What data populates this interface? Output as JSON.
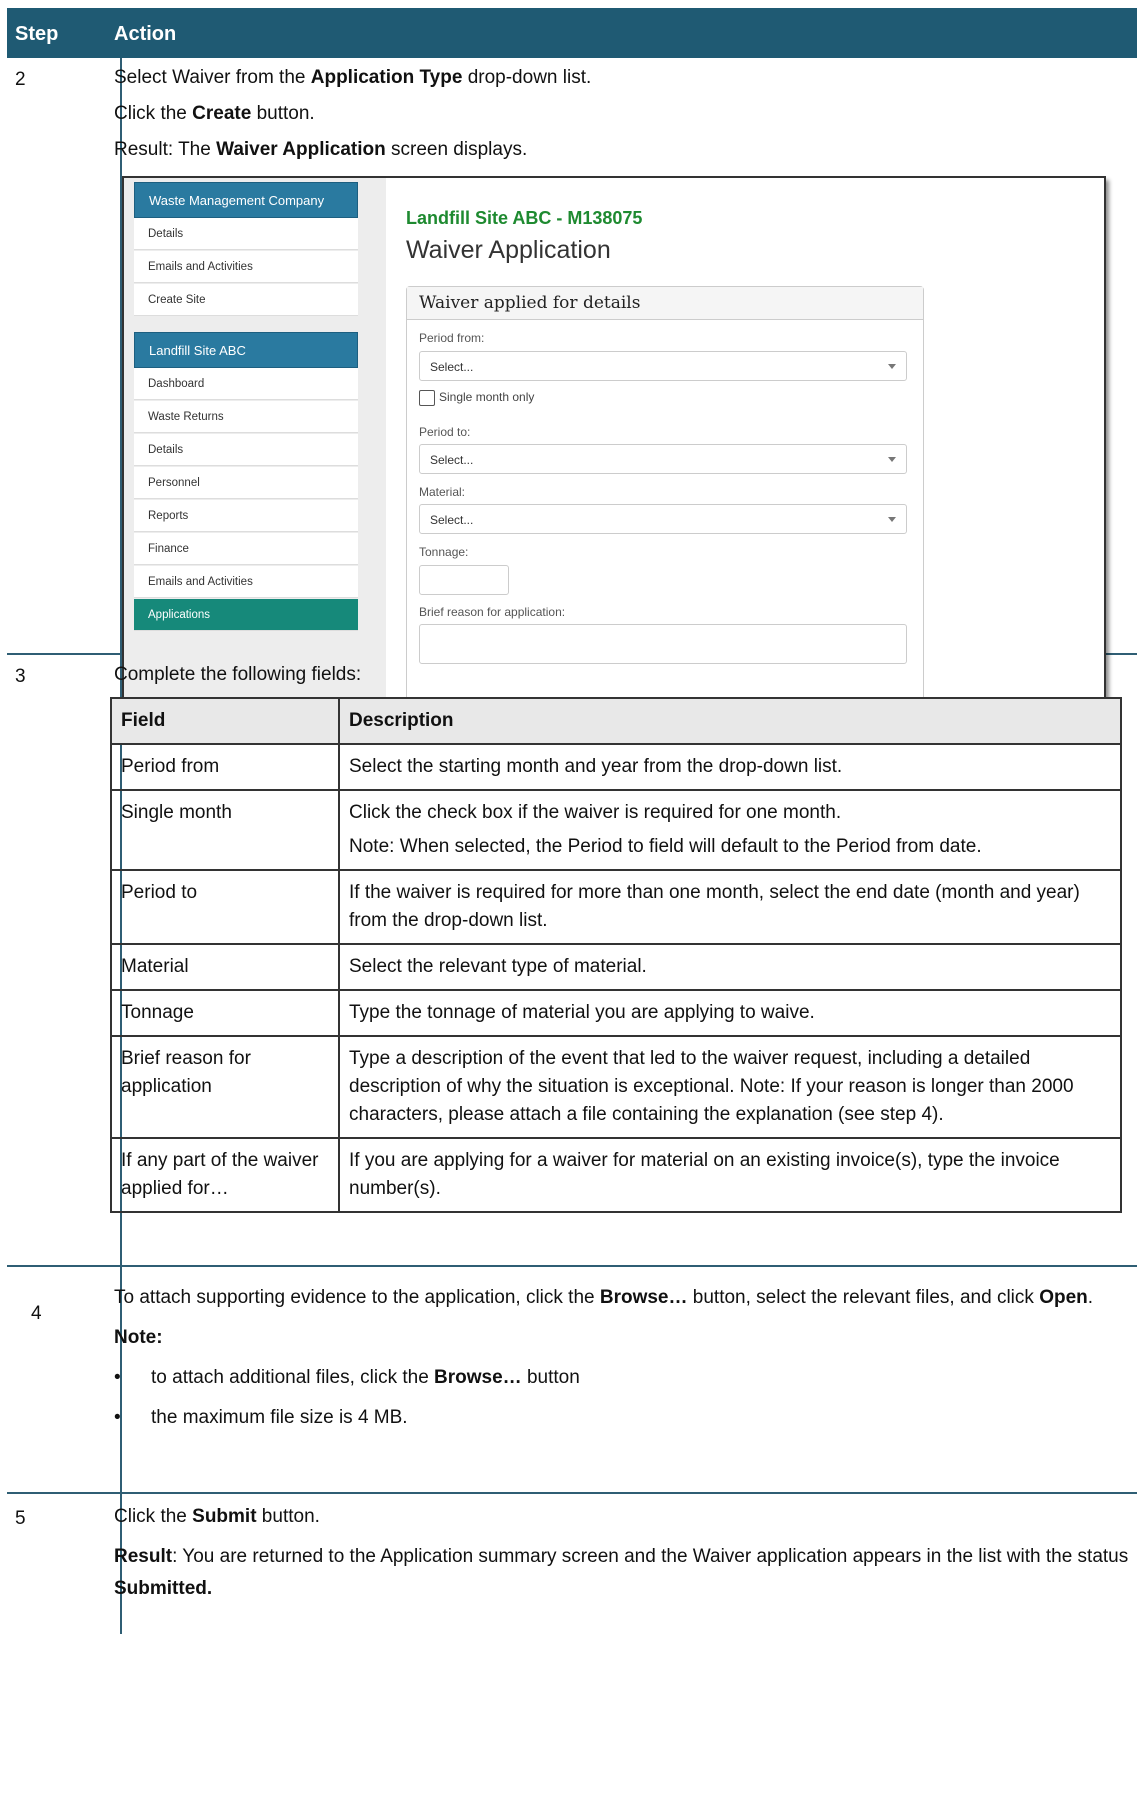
{
  "header": {
    "step": "Step",
    "action": "Action"
  },
  "step2": {
    "num": "2",
    "line1_pre": "Select Waiver from the ",
    "line1_bold": "Application Type",
    "line1_post": " drop-down list.",
    "line2_pre": "Click the ",
    "line2_bold": "Create",
    "line2_post": " button.",
    "line3_pre": "Result: The ",
    "line3_bold": "Waiver Application",
    "line3_post": " screen displays."
  },
  "screenshot": {
    "sidebar": {
      "group1_title": "Waste Management Company",
      "group1_items": [
        "Details",
        "Emails and Activities",
        "Create Site"
      ],
      "group2_title": "Landfill Site ABC",
      "group2_items": [
        "Dashboard",
        "Waste Returns",
        "Details",
        "Personnel",
        "Reports",
        "Finance",
        "Emails and Activities",
        "Applications"
      ]
    },
    "site_title": "Landfill Site ABC - M138075",
    "page_heading": "Waiver Application",
    "panel_title": "Waiver applied for details",
    "period_from_label": "Period from:",
    "period_from_value": "Select...",
    "single_month_label": "Single month only",
    "period_to_label": "Period to:",
    "period_to_value": "Select...",
    "material_label": "Material:",
    "material_value": "Select...",
    "tonnage_label": "Tonnage:",
    "reason_label": "Brief reason for application:"
  },
  "step3": {
    "num": "3",
    "intro": "Complete the following fields:",
    "col_field": "Field",
    "col_desc": "Description",
    "rows": [
      {
        "field": "Period from",
        "desc": "Select the starting month and year from the drop-down list."
      },
      {
        "field": "Single month",
        "desc": "Click the check box if the waiver is required for one month.",
        "desc2": "Note: When selected, the Period to field will default to the Period from date."
      },
      {
        "field": "Period to",
        "desc": "If the waiver is required for more than one month, select the end date (month and year) from the drop-down list."
      },
      {
        "field": "Material",
        "desc": "Select the relevant type of material."
      },
      {
        "field": "Tonnage",
        "desc": "Type the tonnage of material you are applying to waive."
      },
      {
        "field": "Brief reason for application",
        "desc": "Type a description of the event that led to the waiver request, including a detailed description of why the situation is exceptional. Note: If your reason is longer than 2000 characters, please attach a file containing the explanation (see step 4)."
      },
      {
        "field": "If any part of the waiver applied for…",
        "desc": "If you are applying for a waiver for material on an existing invoice(s), type the invoice number(s)."
      }
    ]
  },
  "step4": {
    "num": "4",
    "p1_a": "To attach supporting evidence to the application, click the ",
    "p1_b": "Browse…",
    "p1_c": " button, select the relevant files, and click ",
    "p1_d": "Open",
    "p1_e": ".",
    "note": "Note:",
    "bullet1_a": "to attach additional files, click the ",
    "bullet1_b": "Browse…",
    "bullet1_c": " button",
    "bullet2": "the maximum file size is 4 MB."
  },
  "step5": {
    "num": "5",
    "p1_a": "Click the ",
    "p1_b": "Submit",
    "p1_c": " button.",
    "p2_a": "Result",
    "p2_b": ": You are returned to the Application summary screen and the Waiver application appears in the list with the status ",
    "p2_c": "Submitted."
  }
}
